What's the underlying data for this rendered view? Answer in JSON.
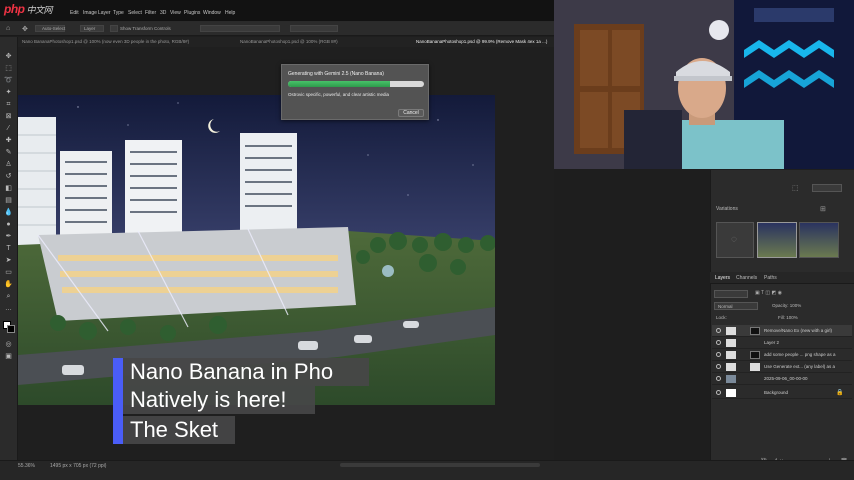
{
  "watermark": {
    "logo": "php",
    "logo_suffix": "中文网"
  },
  "menu": {
    "items": [
      "Edit",
      "Image",
      "Layer",
      "Type",
      "Select",
      "Filter",
      "3D",
      "View",
      "Plugins",
      "Window",
      "Help"
    ]
  },
  "options_bar": {
    "items": [
      "Auto-Select",
      "Layer",
      "Show Transform Controls"
    ]
  },
  "document_tabs": [
    {
      "label": "Nano BananaPhotoshop1.psd @ 100% (now even 3D people in the photo, RGB/8#)",
      "active": false
    },
    {
      "label": "NanoBananaPhotoshop1.psd @ 100% (RGB 8#)",
      "active": false
    },
    {
      "label": "NanoBananaPhotoshop1.psd @ 99.9% (Remove Mask 4ex 1a ...)",
      "active": true
    }
  ],
  "generative_dialog": {
    "title": "Generating with Gemini 2.5 (Nano Banana)",
    "progress": 0.75,
    "prompt": "Ostrovic specific, powerful, and clear artistic media",
    "cancel_label": "Cancel"
  },
  "caption": {
    "line1": "Nano Banana in Pho",
    "line2": "Natively is here!",
    "line3": "The Sket"
  },
  "status_bar": {
    "zoom": "55.36%",
    "doc_size": "1495 px x 705 px (72 ppi)"
  },
  "right_panel": {
    "variations_label": "Variations",
    "layers_tabs": [
      "Layers",
      "Channels",
      "Paths"
    ],
    "blend_mode": "Normal",
    "opacity_label": "Opacity: 100%",
    "fill_label": "Fill: 100%",
    "lock_label": "Lock:",
    "layers": [
      {
        "name": "Remove/Nano Ex (new with a girl)",
        "selected": true
      },
      {
        "name": "Layer 2",
        "selected": false
      },
      {
        "name": "add some people ... png shape as a",
        "selected": false
      },
      {
        "name": "Use Generate ext... (any label) as a",
        "selected": false
      },
      {
        "name": "2025-09-06_00-00-00",
        "selected": false
      },
      {
        "name": "Background",
        "selected": false
      }
    ]
  },
  "colors": {
    "accent_blue": "#4a5df7",
    "progress_green": "#3db85d",
    "app_bg": "#1e1e1e"
  }
}
